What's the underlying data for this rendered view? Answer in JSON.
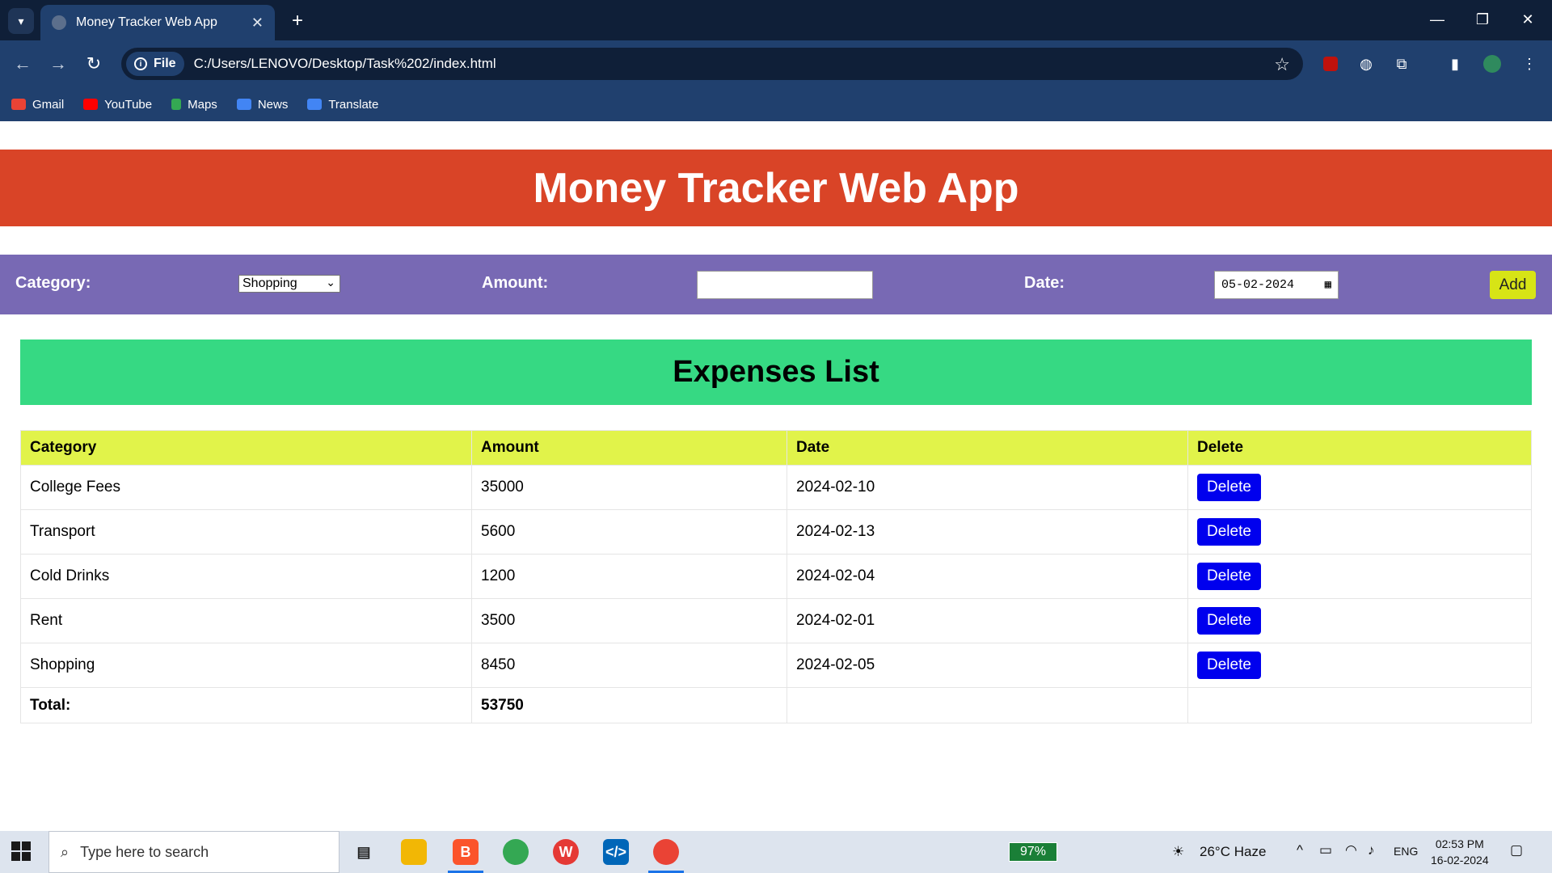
{
  "browser": {
    "tab_title": "Money Tracker Web App",
    "site_chip": "File",
    "url": "C:/Users/LENOVO/Desktop/Task%202/index.html",
    "bookmarks": [
      "Gmail",
      "YouTube",
      "Maps",
      "News",
      "Translate"
    ]
  },
  "app": {
    "title": "Money Tracker Web App",
    "form": {
      "category_label": "Category:",
      "category_value": "Shopping",
      "amount_label": "Amount:",
      "amount_value": "",
      "date_label": "Date:",
      "date_value": "05-02-2024",
      "add_label": "Add"
    },
    "list_title": "Expenses List",
    "table": {
      "headers": [
        "Category",
        "Amount",
        "Date",
        "Delete"
      ],
      "rows": [
        {
          "category": "College Fees",
          "amount": "35000",
          "date": "2024-02-10",
          "action": "Delete"
        },
        {
          "category": "Transport",
          "amount": "5600",
          "date": "2024-02-13",
          "action": "Delete"
        },
        {
          "category": "Cold Drinks",
          "amount": "1200",
          "date": "2024-02-04",
          "action": "Delete"
        },
        {
          "category": "Rent",
          "amount": "3500",
          "date": "2024-02-01",
          "action": "Delete"
        },
        {
          "category": "Shopping",
          "amount": "8450",
          "date": "2024-02-05",
          "action": "Delete"
        }
      ],
      "total_label": "Total:",
      "total_value": "53750"
    }
  },
  "taskbar": {
    "search_placeholder": "Type here to search",
    "battery": "97%",
    "weather": "26°C  Haze",
    "language": "ENG",
    "time": "02:53 PM",
    "date": "16-02-2024"
  },
  "colors": {
    "header_bg": "#d94427",
    "form_bg": "#7869b4",
    "list_title_bg": "#36d983",
    "table_header_bg": "#e1f34a",
    "add_button_bg": "#d7e416",
    "delete_button_bg": "#0000ee"
  }
}
